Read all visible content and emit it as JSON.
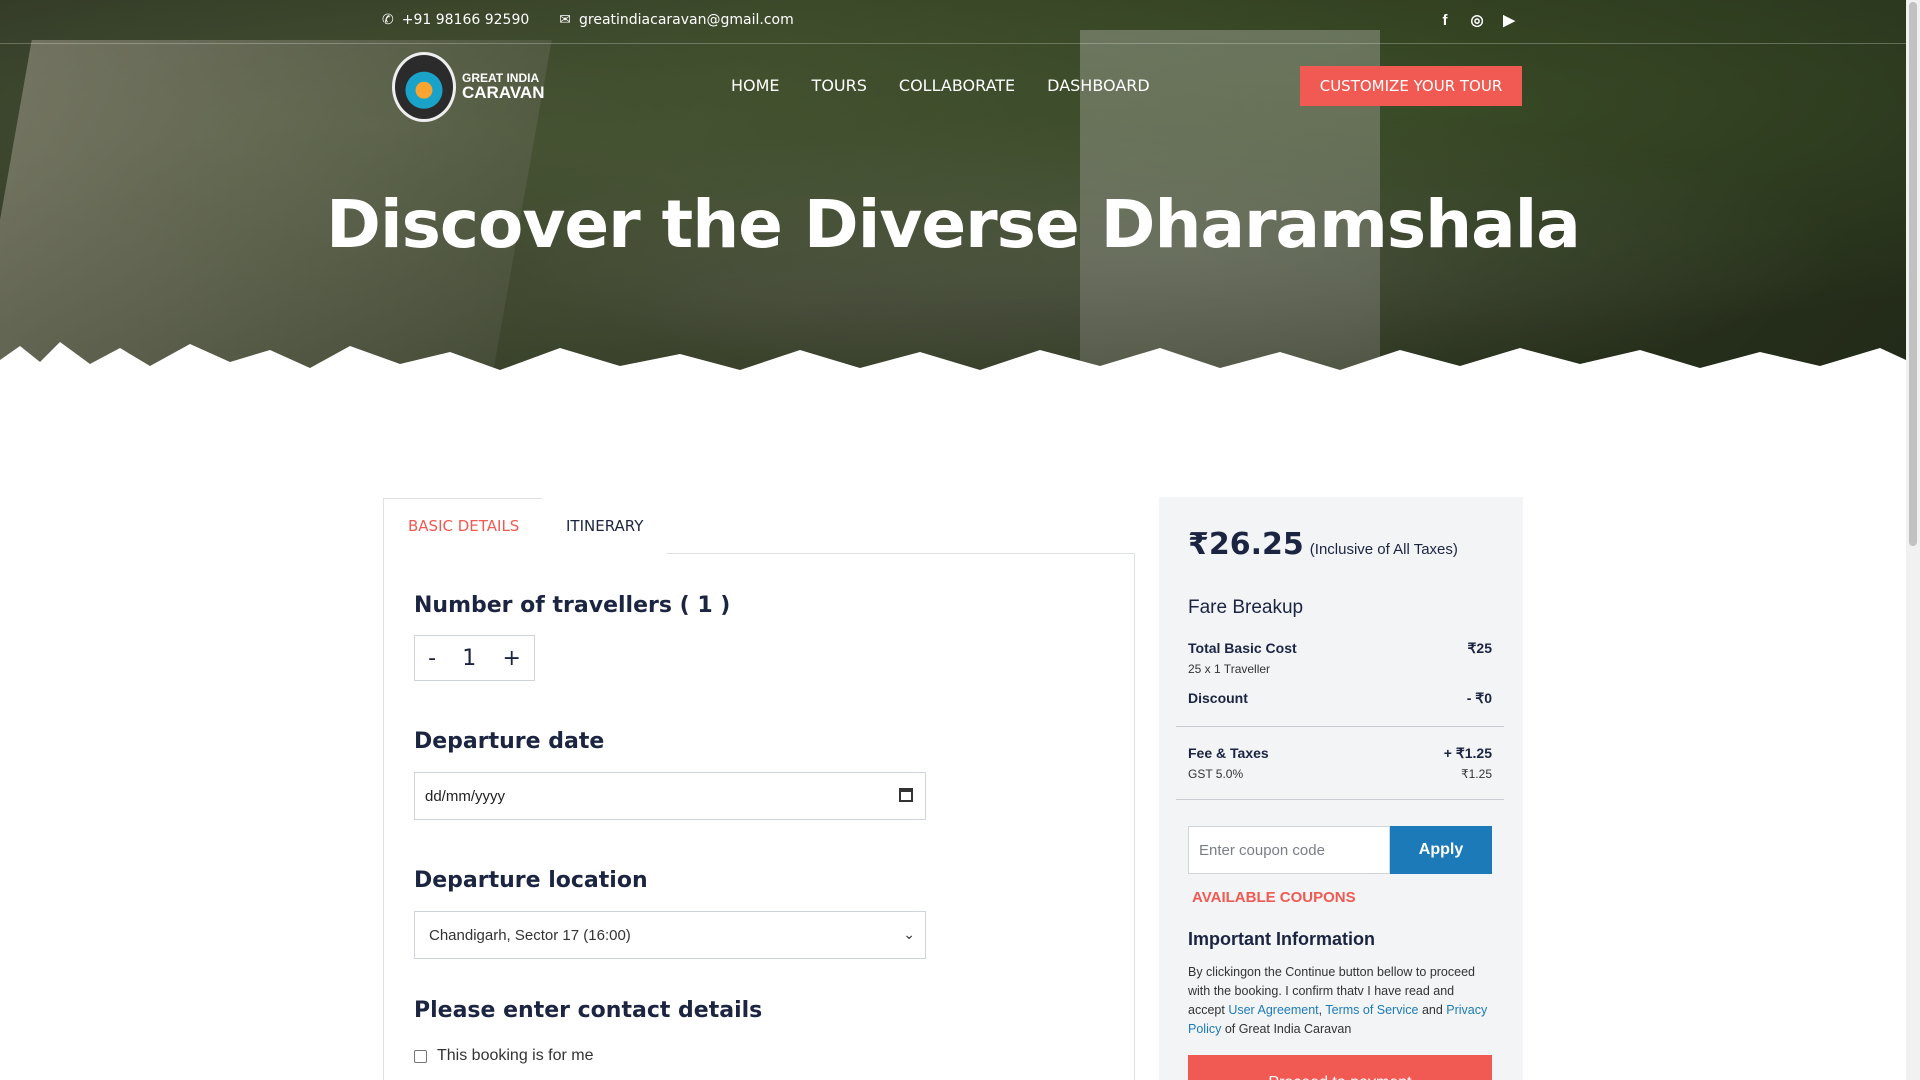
{
  "topbar": {
    "phone": "+91 98166 92590",
    "email": "greatindiacaravan@gmail.com",
    "social": [
      "facebook-icon",
      "instagram-icon",
      "youtube-icon"
    ]
  },
  "logo": {
    "line1": "GREAT INDIA",
    "line2": "CARAVAN"
  },
  "nav": {
    "home": "HOME",
    "tours": "TOURS",
    "collaborate": "COLLABORATE",
    "dashboard": "DASHBOARD"
  },
  "cta": "CUSTOMIZE YOUR TOUR",
  "hero": {
    "title": "Discover the Diverse Dharamshala"
  },
  "tabs": {
    "basic": "BASIC DETAILS",
    "itinerary": "ITINERARY"
  },
  "form": {
    "travellers_heading": "Number of travellers ( 1 )",
    "stepper_minus": "-",
    "stepper_value": "1",
    "stepper_plus": "+",
    "date_heading": "Departure date",
    "date_placeholder": "dd/mm/yyyy",
    "location_heading": "Departure location",
    "location_value": "Chandigarh, Sector 17 (16:00)",
    "contact_heading": "Please enter contact details",
    "self_booking": "This booking is for me"
  },
  "sidebar": {
    "price": "₹26.25",
    "price_note": "(Inclusive of All Taxes)",
    "fare_title": "Fare Breakup",
    "basic_label": "Total Basic Cost",
    "basic_value": "₹25",
    "basic_sub": "25 x 1 Traveller",
    "discount_label": "Discount",
    "discount_value": "- ₹0",
    "fee_label": "Fee & Taxes",
    "fee_value": "+ ₹1.25",
    "gst_label": "GST 5.0%",
    "gst_value": "₹1.25",
    "coupon_placeholder": "Enter coupon code",
    "apply": "Apply",
    "available": "AVAILABLE COUPONS",
    "important_title": "Important Information",
    "important_pre": "By clickingon the Continue button bellow to proceed with the booking. I confirm thatv I have read and accept ",
    "link_agreement": "User Agreement",
    "sep1": ", ",
    "link_terms": "Terms of Service",
    "sep2": " and ",
    "link_privacy": "Privacy Policy",
    "important_post": " of Great India Caravan",
    "proceed": "Proceed to payment"
  },
  "colors": {
    "accent": "#f05a52",
    "primary_blue": "#1d7ab8",
    "navy": "#1b2541"
  }
}
